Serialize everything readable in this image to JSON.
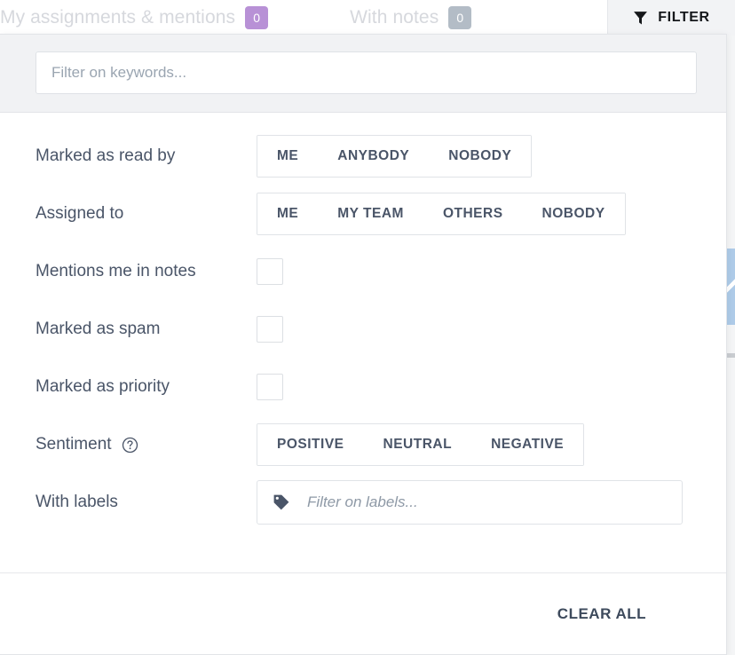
{
  "tabs": [
    {
      "label": "My assignments & mentions",
      "badge": "0",
      "badge_color": "#b891d6"
    },
    {
      "label": "With notes",
      "badge": "0",
      "badge_color": "#b3bcc6"
    }
  ],
  "filter_button": {
    "label": "FILTER",
    "icon": "funnel-icon"
  },
  "panel": {
    "keyword_search": {
      "placeholder": "Filter on keywords...",
      "value": ""
    },
    "rows": [
      {
        "label": "Marked as read by",
        "type": "segmented",
        "options": [
          "ME",
          "ANYBODY",
          "NOBODY"
        ]
      },
      {
        "label": "Assigned to",
        "type": "segmented",
        "options": [
          "ME",
          "MY TEAM",
          "OTHERS",
          "NOBODY"
        ]
      },
      {
        "label": "Mentions me in notes",
        "type": "checkbox",
        "checked": false
      },
      {
        "label": "Marked as spam",
        "type": "checkbox",
        "checked": false
      },
      {
        "label": "Marked as priority",
        "type": "checkbox",
        "checked": false
      },
      {
        "label": "Sentiment",
        "type": "segmented",
        "help_icon": "help-circle-icon",
        "options": [
          "POSITIVE",
          "NEUTRAL",
          "NEGATIVE"
        ]
      },
      {
        "label": "With labels",
        "type": "labels",
        "icon": "tag-icon",
        "placeholder": "Filter on labels...",
        "value": ""
      }
    ],
    "footer": {
      "clear_all_label": "CLEAR ALL"
    }
  }
}
